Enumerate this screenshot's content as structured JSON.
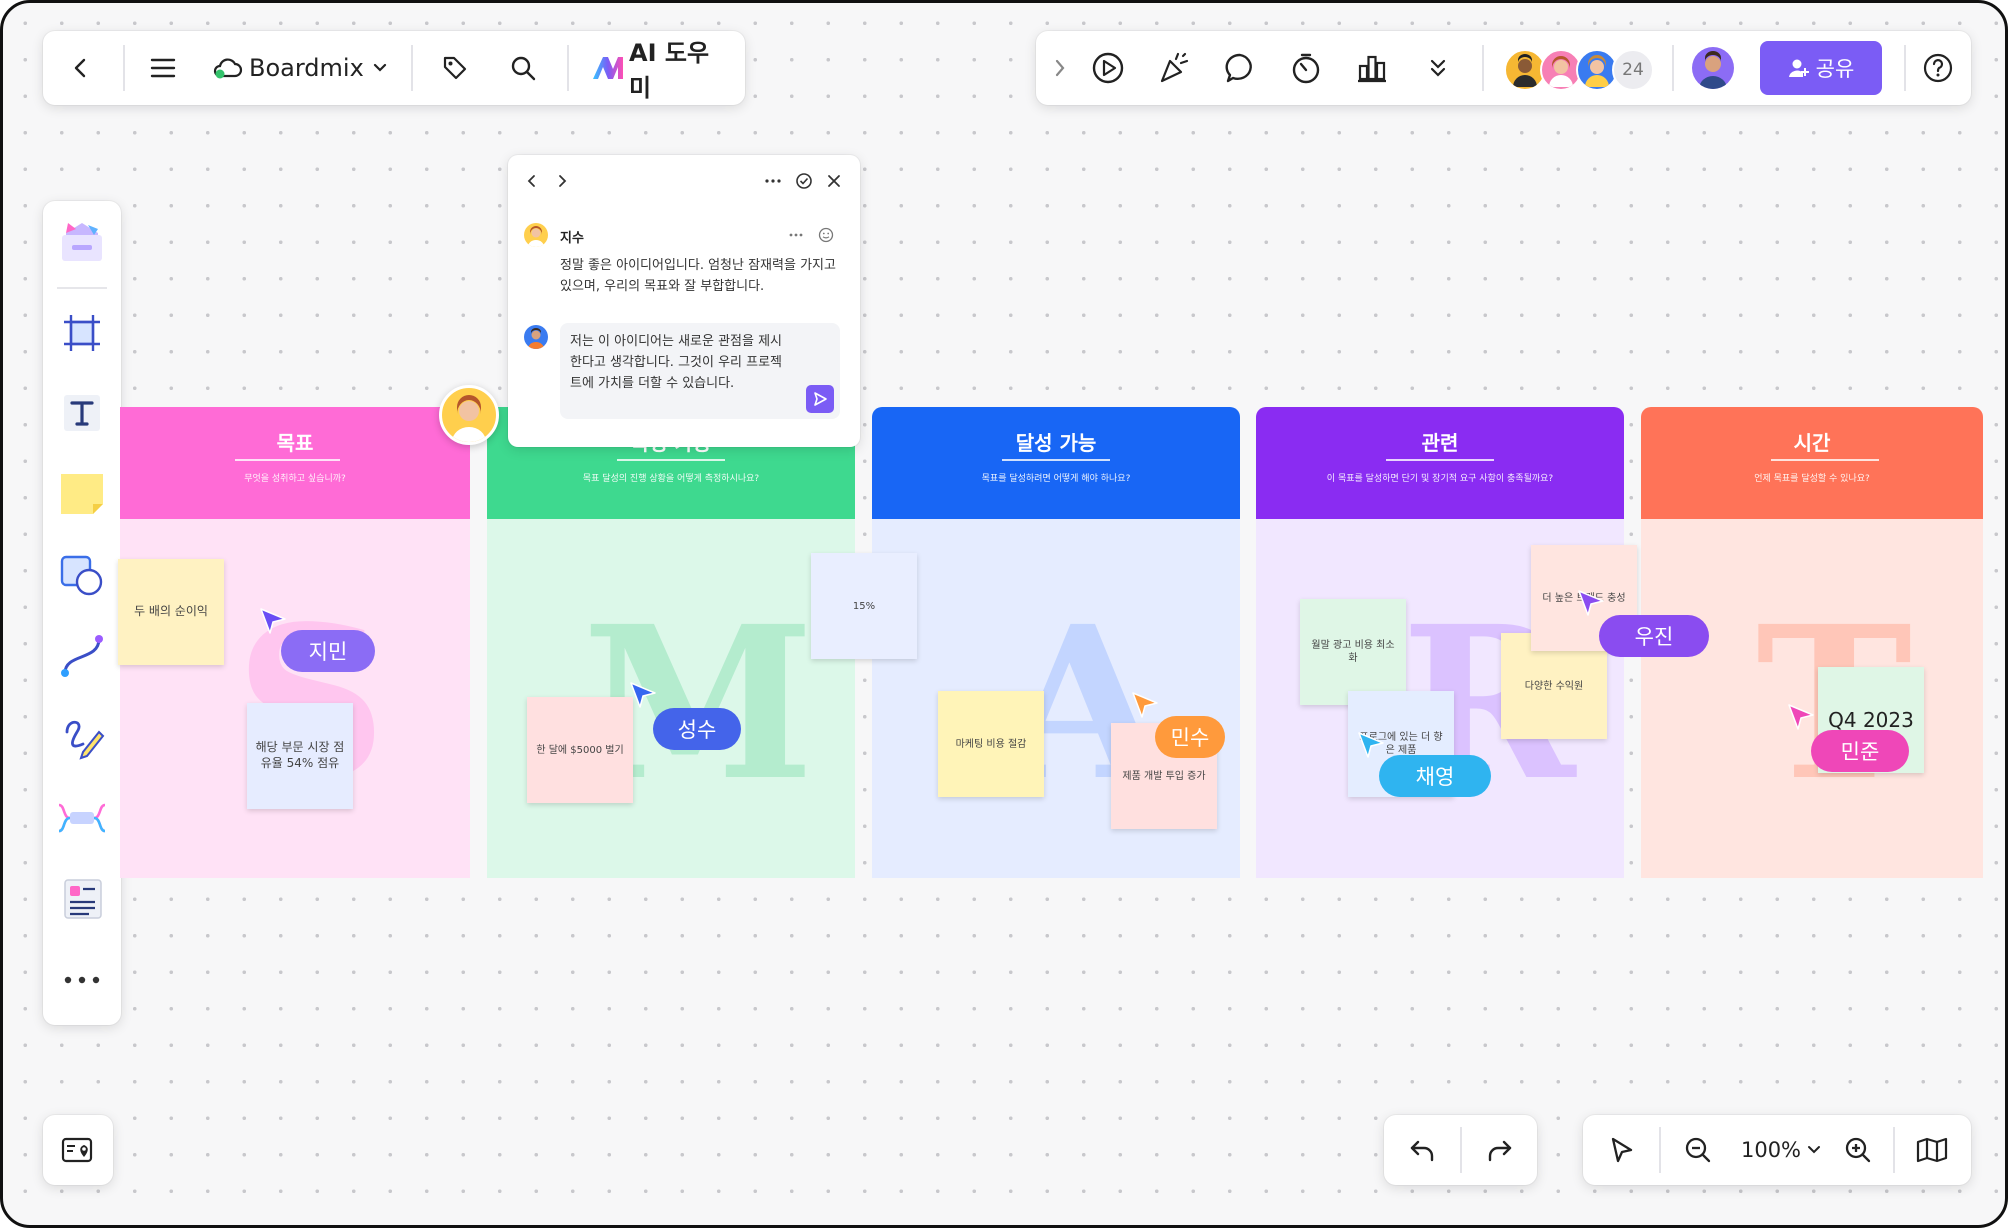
{
  "app": {
    "name": "Boardmix",
    "ai_label": "AI 도우미",
    "collaborator_count": "24",
    "share_label": "공유",
    "zoom": "100%"
  },
  "colors": {
    "accent": "#7b5cf5",
    "pink": "#ff6bd6",
    "green": "#3ed98f",
    "blue": "#1866f5",
    "purple": "#8a2cf2",
    "orange": "#ff7358"
  },
  "icons": {
    "top_left": [
      "back-icon",
      "menu-icon",
      "cloud-icon",
      "tag-icon",
      "search-icon",
      "ai-logo-icon"
    ],
    "top_right": [
      "expand-icon",
      "play-icon",
      "celebrate-icon",
      "comment-icon",
      "timer-icon",
      "vote-icon",
      "more-down-icon",
      "help-icon"
    ],
    "left_toolbar": [
      "templates-icon",
      "frame-icon",
      "text-icon",
      "sticky-note-icon",
      "shapes-icon",
      "connector-icon",
      "pen-icon",
      "mindmap-icon",
      "list-icon",
      "more-icon"
    ],
    "bottom": [
      "map-pin-icon",
      "undo-icon",
      "redo-icon",
      "select-icon",
      "zoom-out-icon",
      "zoom-in-icon",
      "minimap-icon"
    ]
  },
  "comment": {
    "author": "지수",
    "message_line1": "정말 좋은 아이디어입니다. 엄청난 잠재력을 가지고",
    "message_line2": "있으며, 우리의 목표와 잘 부합합니다.",
    "reply_line1": "저는 이 아이디어는 새로운 관점을 제시",
    "reply_line2": "한다고 생각합니다. 그것이 우리 프로젝",
    "reply_line3": "트에 가치를 더할 수 있습니다."
  },
  "columns": [
    {
      "title": "목표",
      "subtitle": "무엇을 성취하고 싶습니까?",
      "letter": "S"
    },
    {
      "title": "측정 가능",
      "subtitle": "목표 달성의 진행 상황을 어떻게 측정하시나요?",
      "letter": "M"
    },
    {
      "title": "달성 가능",
      "subtitle": "목표를 달성하려면 어떻게 해야 하나요?",
      "letter": "A"
    },
    {
      "title": "관련",
      "subtitle": "이 목표를 달성하면 단기 및 장기적 요구 사항이 충족될까요?",
      "letter": "R"
    },
    {
      "title": "시간",
      "subtitle": "언제 목표를 달성할 수 있나요?",
      "letter": "T"
    }
  ],
  "notes": {
    "n1": "두 배의 순이익",
    "n2": "해당 부문 시장 점유율 54% 점유",
    "n3": "한 달에 $5000 벌기",
    "n4": "15%",
    "n5": "마케팅 비용 절감",
    "n6": "제품 개발 투입 증가",
    "n7": "월말 광고 비용 최소화",
    "n8": "프로그에 있는 더 향은 제품",
    "n9": "다양한 수익원",
    "n10": "더 높은 브랜드 충성",
    "n11": "Q4 2023"
  },
  "cursors": {
    "c1": "지민",
    "c2": "성수",
    "c3": "민수",
    "c4": "채영",
    "c5": "우진",
    "c6": "민준"
  }
}
